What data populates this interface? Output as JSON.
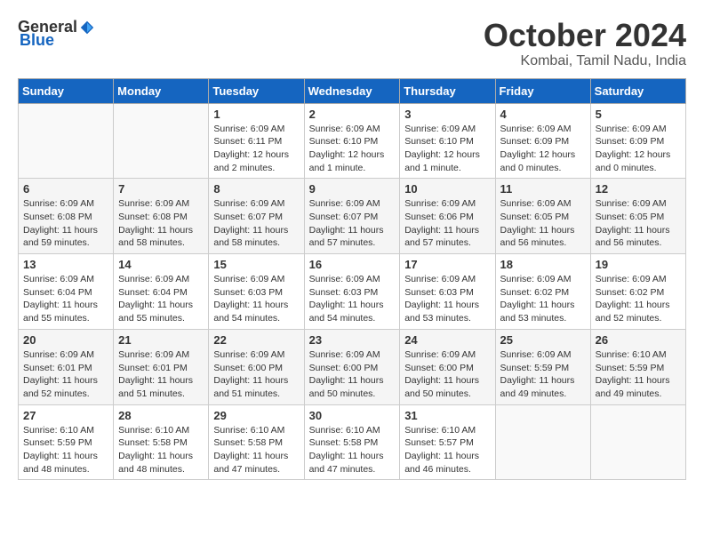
{
  "header": {
    "logo_general": "General",
    "logo_blue": "Blue",
    "month_title": "October 2024",
    "location": "Kombai, Tamil Nadu, India"
  },
  "calendar": {
    "columns": [
      "Sunday",
      "Monday",
      "Tuesday",
      "Wednesday",
      "Thursday",
      "Friday",
      "Saturday"
    ],
    "rows": [
      [
        {
          "day": "",
          "info": ""
        },
        {
          "day": "",
          "info": ""
        },
        {
          "day": "1",
          "info": "Sunrise: 6:09 AM\nSunset: 6:11 PM\nDaylight: 12 hours\nand 2 minutes."
        },
        {
          "day": "2",
          "info": "Sunrise: 6:09 AM\nSunset: 6:10 PM\nDaylight: 12 hours\nand 1 minute."
        },
        {
          "day": "3",
          "info": "Sunrise: 6:09 AM\nSunset: 6:10 PM\nDaylight: 12 hours\nand 1 minute."
        },
        {
          "day": "4",
          "info": "Sunrise: 6:09 AM\nSunset: 6:09 PM\nDaylight: 12 hours\nand 0 minutes."
        },
        {
          "day": "5",
          "info": "Sunrise: 6:09 AM\nSunset: 6:09 PM\nDaylight: 12 hours\nand 0 minutes."
        }
      ],
      [
        {
          "day": "6",
          "info": "Sunrise: 6:09 AM\nSunset: 6:08 PM\nDaylight: 11 hours\nand 59 minutes."
        },
        {
          "day": "7",
          "info": "Sunrise: 6:09 AM\nSunset: 6:08 PM\nDaylight: 11 hours\nand 58 minutes."
        },
        {
          "day": "8",
          "info": "Sunrise: 6:09 AM\nSunset: 6:07 PM\nDaylight: 11 hours\nand 58 minutes."
        },
        {
          "day": "9",
          "info": "Sunrise: 6:09 AM\nSunset: 6:07 PM\nDaylight: 11 hours\nand 57 minutes."
        },
        {
          "day": "10",
          "info": "Sunrise: 6:09 AM\nSunset: 6:06 PM\nDaylight: 11 hours\nand 57 minutes."
        },
        {
          "day": "11",
          "info": "Sunrise: 6:09 AM\nSunset: 6:05 PM\nDaylight: 11 hours\nand 56 minutes."
        },
        {
          "day": "12",
          "info": "Sunrise: 6:09 AM\nSunset: 6:05 PM\nDaylight: 11 hours\nand 56 minutes."
        }
      ],
      [
        {
          "day": "13",
          "info": "Sunrise: 6:09 AM\nSunset: 6:04 PM\nDaylight: 11 hours\nand 55 minutes."
        },
        {
          "day": "14",
          "info": "Sunrise: 6:09 AM\nSunset: 6:04 PM\nDaylight: 11 hours\nand 55 minutes."
        },
        {
          "day": "15",
          "info": "Sunrise: 6:09 AM\nSunset: 6:03 PM\nDaylight: 11 hours\nand 54 minutes."
        },
        {
          "day": "16",
          "info": "Sunrise: 6:09 AM\nSunset: 6:03 PM\nDaylight: 11 hours\nand 54 minutes."
        },
        {
          "day": "17",
          "info": "Sunrise: 6:09 AM\nSunset: 6:03 PM\nDaylight: 11 hours\nand 53 minutes."
        },
        {
          "day": "18",
          "info": "Sunrise: 6:09 AM\nSunset: 6:02 PM\nDaylight: 11 hours\nand 53 minutes."
        },
        {
          "day": "19",
          "info": "Sunrise: 6:09 AM\nSunset: 6:02 PM\nDaylight: 11 hours\nand 52 minutes."
        }
      ],
      [
        {
          "day": "20",
          "info": "Sunrise: 6:09 AM\nSunset: 6:01 PM\nDaylight: 11 hours\nand 52 minutes."
        },
        {
          "day": "21",
          "info": "Sunrise: 6:09 AM\nSunset: 6:01 PM\nDaylight: 11 hours\nand 51 minutes."
        },
        {
          "day": "22",
          "info": "Sunrise: 6:09 AM\nSunset: 6:00 PM\nDaylight: 11 hours\nand 51 minutes."
        },
        {
          "day": "23",
          "info": "Sunrise: 6:09 AM\nSunset: 6:00 PM\nDaylight: 11 hours\nand 50 minutes."
        },
        {
          "day": "24",
          "info": "Sunrise: 6:09 AM\nSunset: 6:00 PM\nDaylight: 11 hours\nand 50 minutes."
        },
        {
          "day": "25",
          "info": "Sunrise: 6:09 AM\nSunset: 5:59 PM\nDaylight: 11 hours\nand 49 minutes."
        },
        {
          "day": "26",
          "info": "Sunrise: 6:10 AM\nSunset: 5:59 PM\nDaylight: 11 hours\nand 49 minutes."
        }
      ],
      [
        {
          "day": "27",
          "info": "Sunrise: 6:10 AM\nSunset: 5:59 PM\nDaylight: 11 hours\nand 48 minutes."
        },
        {
          "day": "28",
          "info": "Sunrise: 6:10 AM\nSunset: 5:58 PM\nDaylight: 11 hours\nand 48 minutes."
        },
        {
          "day": "29",
          "info": "Sunrise: 6:10 AM\nSunset: 5:58 PM\nDaylight: 11 hours\nand 47 minutes."
        },
        {
          "day": "30",
          "info": "Sunrise: 6:10 AM\nSunset: 5:58 PM\nDaylight: 11 hours\nand 47 minutes."
        },
        {
          "day": "31",
          "info": "Sunrise: 6:10 AM\nSunset: 5:57 PM\nDaylight: 11 hours\nand 46 minutes."
        },
        {
          "day": "",
          "info": ""
        },
        {
          "day": "",
          "info": ""
        }
      ]
    ]
  }
}
